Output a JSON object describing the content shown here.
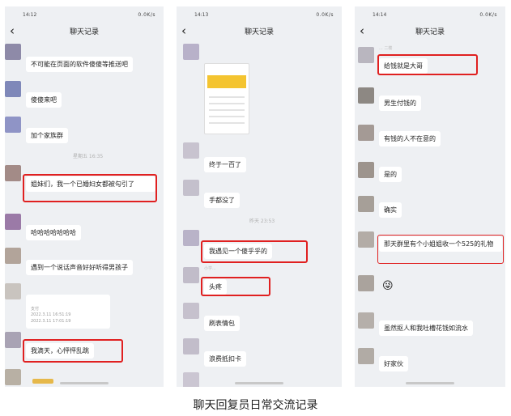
{
  "caption": "聊天回复员日常交流记录",
  "header_title": "聊天记录",
  "panels": [
    {
      "time": "14:12",
      "net": "0.0K/s",
      "messages": [
        "不可能在页面的软件傻傻等推送吧",
        "傻傻来吧",
        "加个家族群",
        "姐妹们，我一个已婚妇女都被勾引了",
        "哈哈哈哈哈哈哈",
        "遇到一个说话声音好好听得男孩子",
        "我滴天，心怦怦乱跳"
      ],
      "timestamp": "星期五 16:35",
      "card": {
        "title": "支付",
        "line1": "2022.3.11 16:51:19",
        "line2": "2022.3.11 17:01:19"
      }
    },
    {
      "time": "14:13",
      "net": "0.0K/s",
      "messages": [
        "终于一百了",
        "手都没了",
        "我遇见一个傻乎乎的",
        "头疼",
        "刷表情包",
        "浪费抵扣卡"
      ],
      "timestamp": "昨天 23:53",
      "nick": "小学..."
    },
    {
      "time": "14:14",
      "net": "0.0K/s",
      "messages": [
        "给钱就是大哥",
        "男生付钱的",
        "有钱的人不在意的",
        "是的",
        "确实",
        "那天群里有个小姐姐收一个525的礼物",
        "😜",
        "虽然抠人和我吐槽花钱如流水",
        "好家伙"
      ],
      "nick": "... 二楼"
    }
  ]
}
